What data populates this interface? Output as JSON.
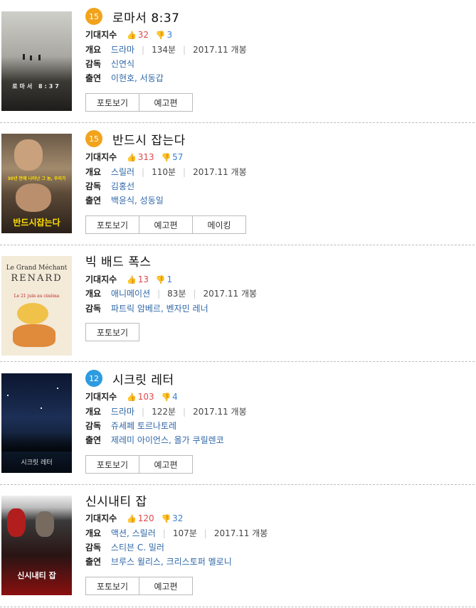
{
  "labels": {
    "expect": "기대지수",
    "overview": "개요",
    "director": "감독",
    "cast": "출연"
  },
  "icons": {
    "thumbs_up": "thumbs-up-icon",
    "thumbs_down": "thumbs-down-icon"
  },
  "colors": {
    "rating15": "#f2a31c",
    "rating12": "#2d9be0",
    "up": "#e0474c",
    "down": "#3d7fd1"
  },
  "movies": [
    {
      "rating": "15",
      "title": "로마서 8:37",
      "up": "32",
      "down": "3",
      "genre": "드라마",
      "runtime": "134분",
      "release": "2017.11 개봉",
      "director": "신연식",
      "cast": "이현호, 서동갑",
      "buttons": [
        "포토보기",
        "예고편"
      ],
      "poster_text": "로마서 8:37"
    },
    {
      "rating": "15",
      "title": "반드시 잡는다",
      "up": "313",
      "down": "57",
      "genre": "스릴러",
      "runtime": "110분",
      "release": "2017.11 개봉",
      "director": "김홍선",
      "cast": "백윤식, 성동일",
      "buttons": [
        "포토보기",
        "예고편",
        "메이킹"
      ],
      "poster_text": "반드시잡는다",
      "poster_sub": "30년 만에 나타난 그 놈, 우리가"
    },
    {
      "rating": "",
      "title": "빅 배드 폭스",
      "up": "13",
      "down": "1",
      "genre": "애니메이션",
      "runtime": "83분",
      "release": "2017.11 개봉",
      "director": "파트릭 암베르, 벤자민 레너",
      "cast": "",
      "buttons": [
        "포토보기"
      ],
      "poster_text": "Le Grand Méchant",
      "poster_sub": "RENARD",
      "poster_note": "Le 21 juin au cinéma"
    },
    {
      "rating": "12",
      "title": "시크릿 레터",
      "up": "103",
      "down": "4",
      "genre": "드라마",
      "runtime": "122분",
      "release": "2017.11 개봉",
      "director": "쥬세페 토르나토레",
      "cast": "제레미 아이언스, 올가 쿠릴렌코",
      "buttons": [
        "포토보기",
        "예고편"
      ],
      "poster_text": "시크릿 레터"
    },
    {
      "rating": "",
      "title": "신시내티 잡",
      "up": "120",
      "down": "32",
      "genre": "액션, 스릴러",
      "runtime": "107분",
      "release": "2017.11 개봉",
      "director": "스티븐 C. 밀러",
      "cast": "브루스 윌리스, 크리스토퍼 멜로니",
      "buttons": [
        "포토보기",
        "예고편"
      ],
      "poster_text": "신시내티 잡"
    }
  ]
}
